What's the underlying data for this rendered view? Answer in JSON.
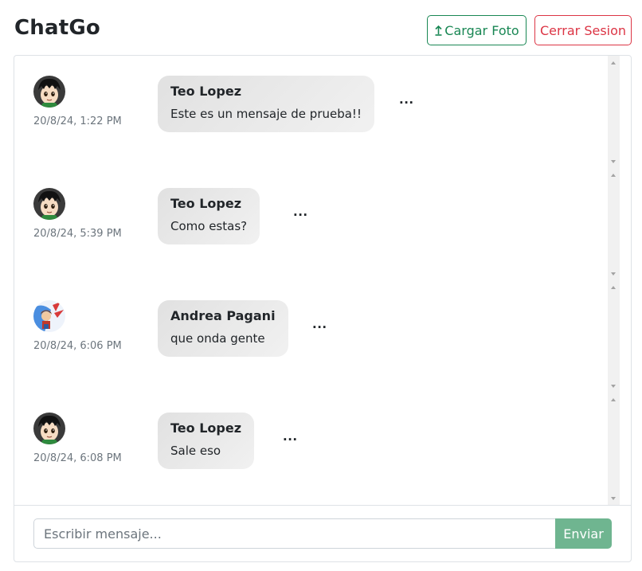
{
  "header": {
    "title": "ChatGo",
    "upload_label": "Cargar Foto",
    "logout_label": "Cerrar Sesion"
  },
  "messages": [
    {
      "sender": "Teo Lopez",
      "text": "Este es un mensaje de prueba!!",
      "timestamp": "20/8/24, 1:22 PM",
      "more": "...",
      "avatar": "teo-avatar"
    },
    {
      "sender": "Teo Lopez",
      "text": "Como estas?",
      "timestamp": "20/8/24, 5:39 PM",
      "more": "...",
      "avatar": "teo-avatar"
    },
    {
      "sender": "Andrea Pagani",
      "text": "que onda gente",
      "timestamp": "20/8/24, 6:06 PM",
      "more": "...",
      "avatar": "andrea-avatar"
    },
    {
      "sender": "Teo Lopez",
      "text": "Sale eso",
      "timestamp": "20/8/24, 6:08 PM",
      "more": "...",
      "avatar": "teo-avatar"
    }
  ],
  "composer": {
    "placeholder": "Escribir mensaje...",
    "value": "",
    "send_label": "Enviar"
  },
  "colors": {
    "success": "#198754",
    "danger": "#dc3545",
    "send_button": "#6fb590",
    "bubble": "#e6e6e6"
  }
}
